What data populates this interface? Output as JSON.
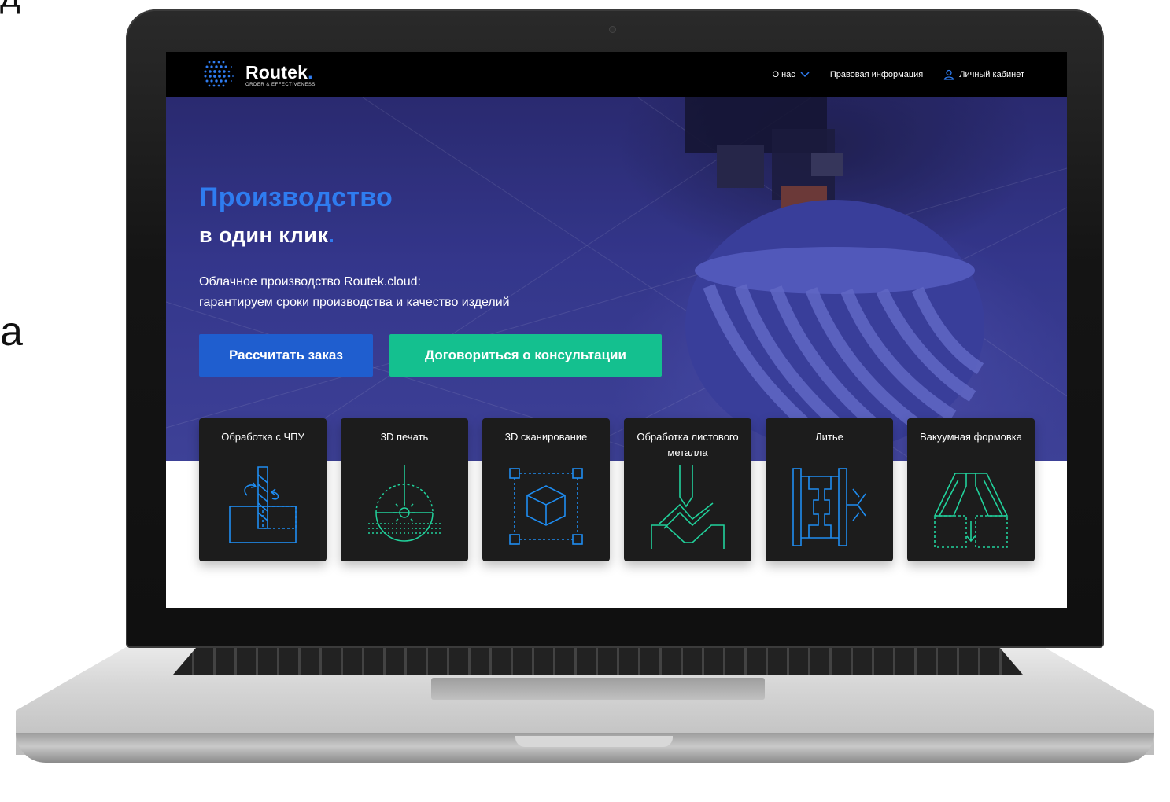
{
  "edge_text": {
    "top": "д",
    "middle": "а"
  },
  "nav": {
    "logo_name": "Routek",
    "logo_dot": ".",
    "logo_tagline": "ORDER & EFFECTIVENESS",
    "links": [
      {
        "label": "О нас",
        "icon": "chevron-down-icon"
      },
      {
        "label": "Правовая информация"
      },
      {
        "label": "Личный кабинет",
        "icon": "user-icon"
      }
    ]
  },
  "hero": {
    "title_line1": "Производство",
    "title_line2": "в один клик",
    "title_dot": ".",
    "subtitle_line1": "Облачное производство Routek.cloud:",
    "subtitle_line2": "гарантируем сроки производства и качество изделий",
    "primary_button": "Рассчитать заказ",
    "secondary_button": "Договориться о консультации"
  },
  "services": [
    {
      "title": "Обработка с ЧПУ",
      "icon": "cnc-drill-icon"
    },
    {
      "title": "3D печать",
      "icon": "3d-print-icon"
    },
    {
      "title": "3D сканирование",
      "icon": "3d-scan-icon"
    },
    {
      "title": "Обработка листового металла",
      "icon": "sheet-metal-bend-icon"
    },
    {
      "title": "Литье",
      "icon": "casting-mold-icon"
    },
    {
      "title": "Вакуумная формовка",
      "icon": "vacuum-forming-icon"
    }
  ],
  "colors": {
    "accent_blue": "#2f7cf0",
    "button_blue": "#1f5ecf",
    "button_green": "#14c08f",
    "icon_blue": "#1e8cf0",
    "icon_green": "#21d19b",
    "card_bg": "#1c1c1c"
  }
}
